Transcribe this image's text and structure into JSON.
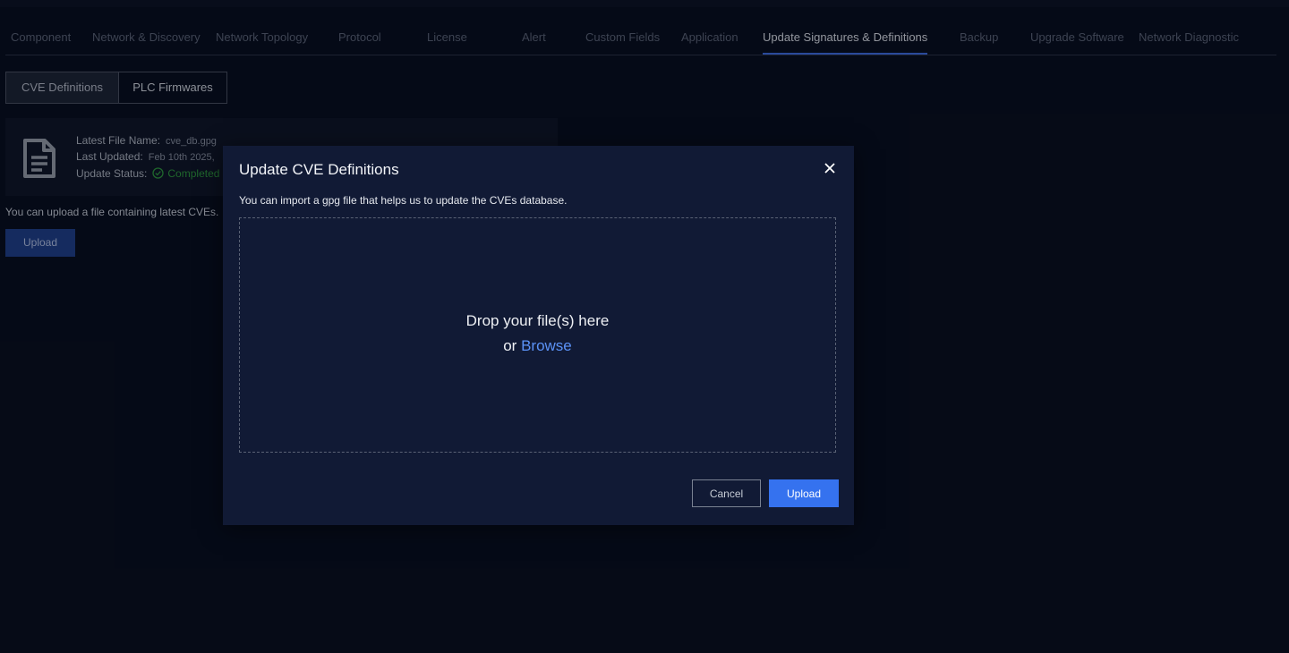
{
  "nav": {
    "tabs": [
      {
        "label": "Component"
      },
      {
        "label": "Network & Discovery"
      },
      {
        "label": "Network Topology"
      },
      {
        "label": "Protocol"
      },
      {
        "label": "License"
      },
      {
        "label": "Alert"
      },
      {
        "label": "Custom Fields"
      },
      {
        "label": "Application"
      },
      {
        "label": "Update Signatures & Definitions",
        "active": true
      },
      {
        "label": "Backup"
      },
      {
        "label": "Upgrade Software"
      },
      {
        "label": "Network Diagnostic"
      }
    ]
  },
  "subtabs": [
    {
      "label": "CVE Definitions"
    },
    {
      "label": "PLC Firmwares"
    }
  ],
  "info": {
    "file_name_label": "Latest File Name:",
    "file_name_value": "cve_db.gpg",
    "last_updated_label": "Last Updated:",
    "last_updated_value": "Feb 10th 2025,",
    "status_label": "Update Status:",
    "status_value": "Completed",
    "status_color": "#2f9a3c"
  },
  "page": {
    "upload_hint": "You can upload a file containing latest CVEs.",
    "upload_button": "Upload"
  },
  "modal": {
    "title": "Update CVE Definitions",
    "description": "You can import a gpg file that helps us to update the CVEs database.",
    "drop_text": "Drop your file(s) here",
    "or_text": "or",
    "browse_text": "Browse",
    "cancel_label": "Cancel",
    "upload_label": "Upload",
    "accent_color": "#3572ef"
  },
  "icons": {
    "document": "document-icon",
    "check": "check-circle-icon",
    "close": "close-icon"
  }
}
